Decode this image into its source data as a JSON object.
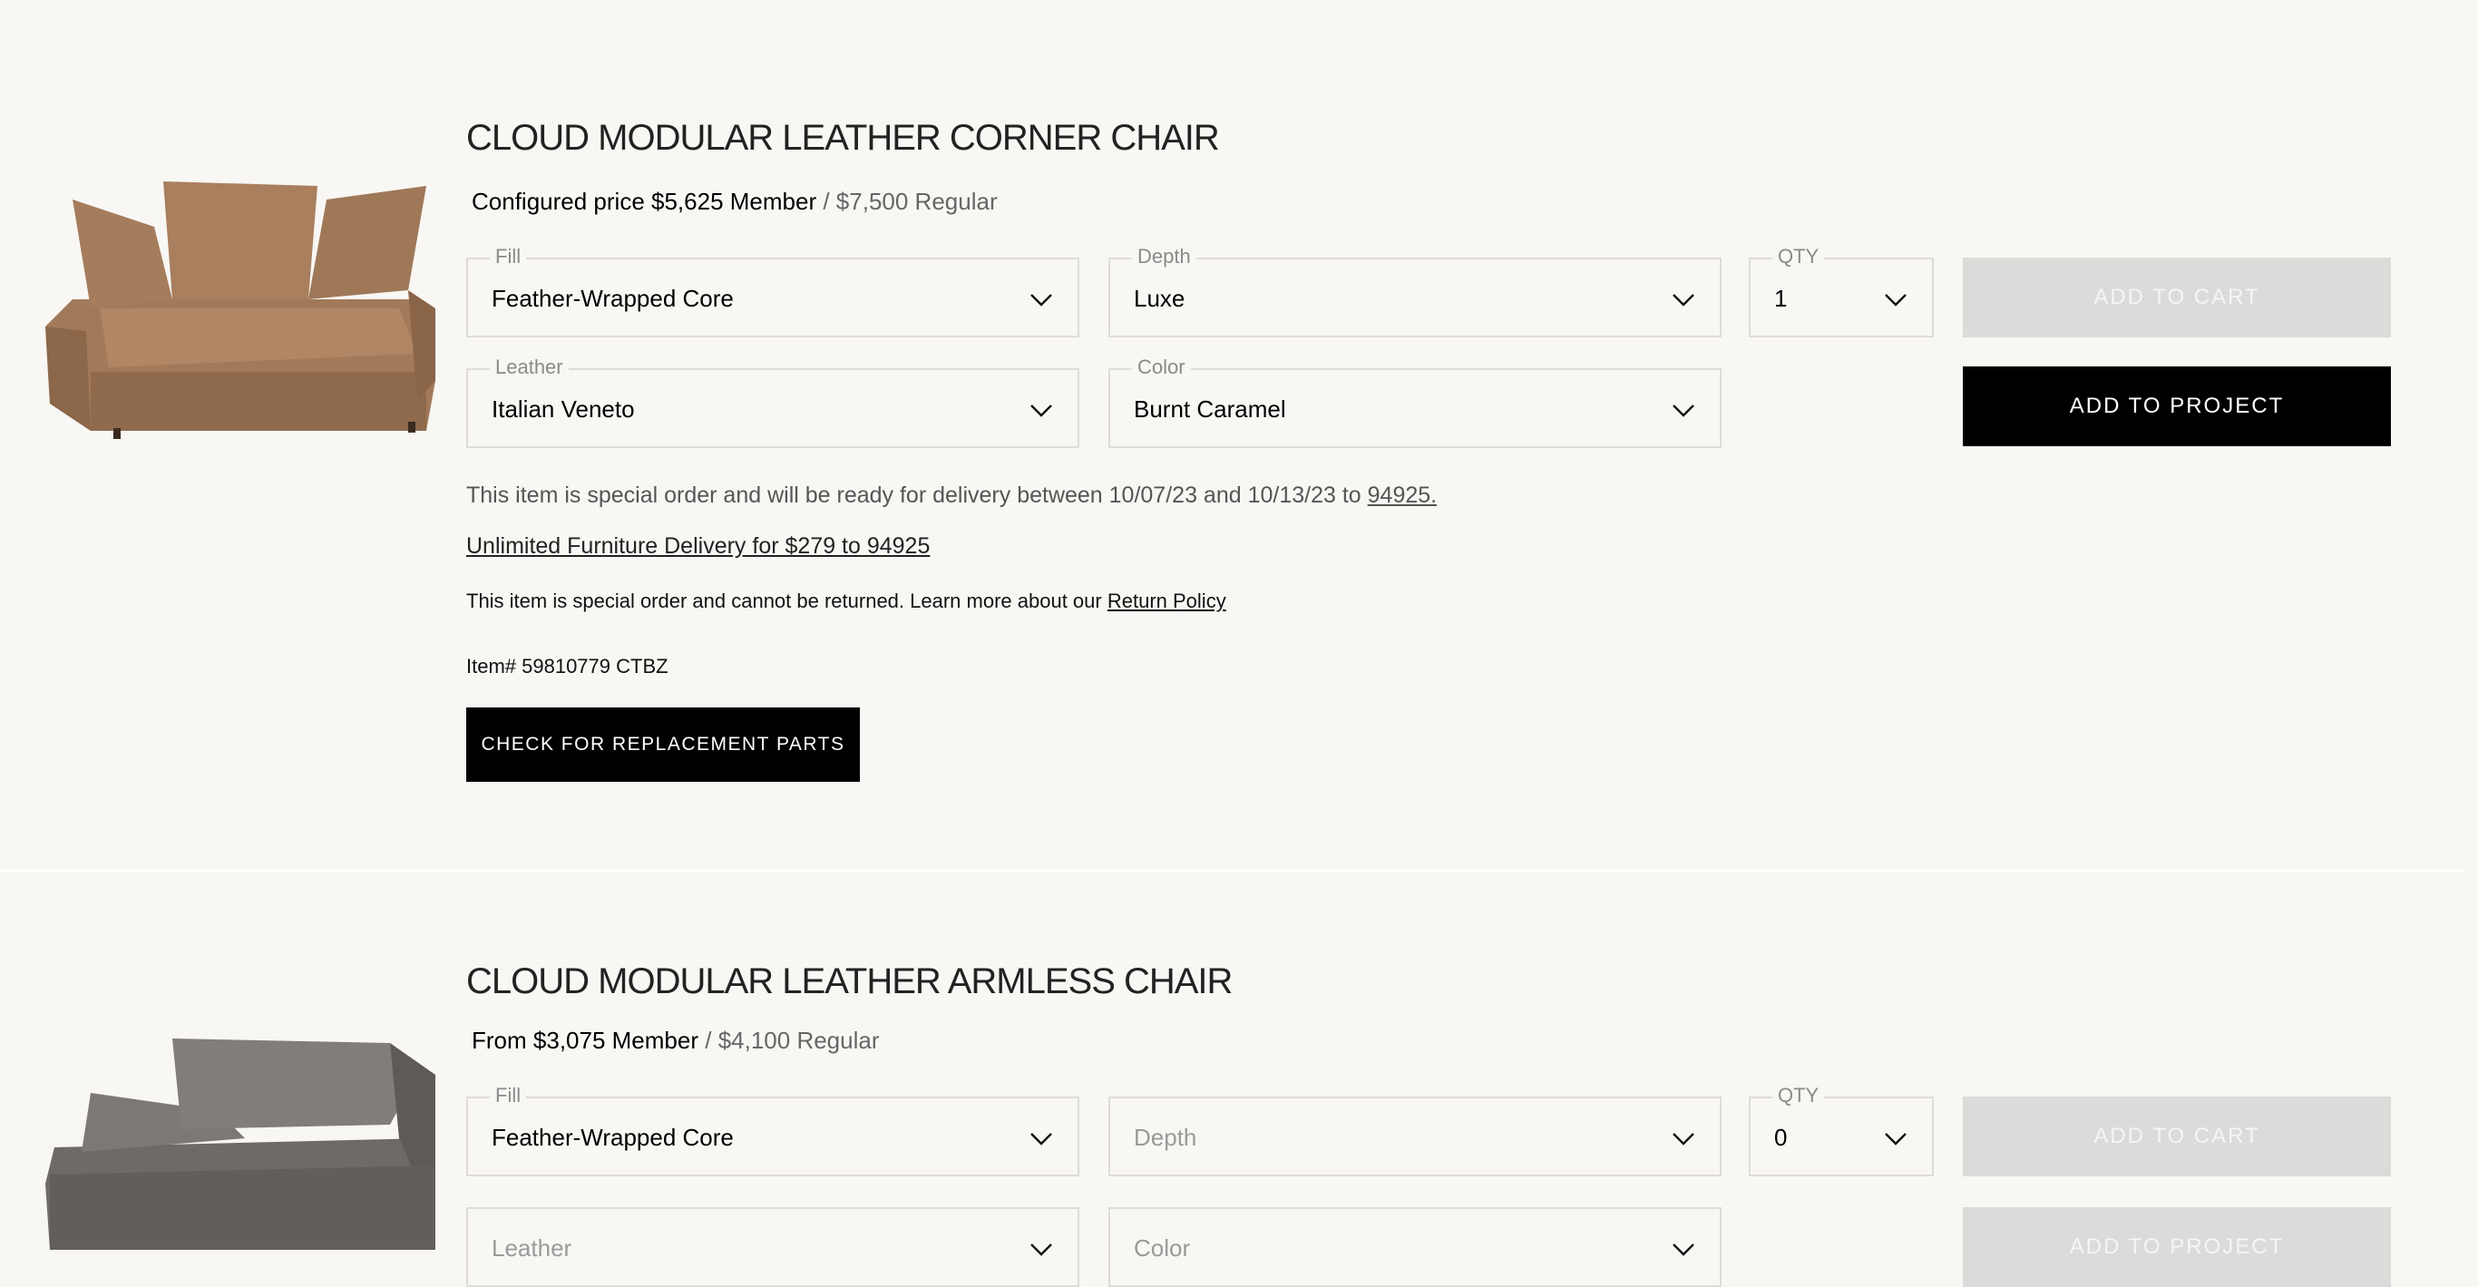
{
  "products": [
    {
      "title": "CLOUD MODULAR LEATHER CORNER CHAIR",
      "price_prefix": "Configured price",
      "member_price": "$5,625 Member",
      "regular_price": "/ $7,500 Regular",
      "fields": {
        "fill": {
          "label": "Fill",
          "value": "Feather-Wrapped Core"
        },
        "depth": {
          "label": "Depth",
          "value": "Luxe"
        },
        "qty": {
          "label": "QTY",
          "value": "1"
        },
        "leather": {
          "label": "Leather",
          "value": "Italian Veneto"
        },
        "color": {
          "label": "Color",
          "value": "Burnt Caramel"
        }
      },
      "add_to_cart": "ADD TO CART",
      "add_to_project": "ADD TO PROJECT",
      "delivery_text": "This item is special order and will be ready for delivery between 10/07/23 and 10/13/23 to",
      "delivery_zip": "94925.",
      "unlimited_delivery": "Unlimited Furniture Delivery for $279 to 94925",
      "return_text": "This item is special order and cannot be returned. Learn more about our",
      "return_link": "Return Policy",
      "item_number": "Item# 59810779 CTBZ",
      "replacement_parts": "CHECK FOR REPLACEMENT PARTS",
      "image_color": "#9a7456"
    },
    {
      "title": "CLOUD MODULAR LEATHER ARMLESS CHAIR",
      "price_prefix": "From",
      "member_price": "$3,075 Member",
      "regular_price": "/ $4,100 Regular",
      "fields": {
        "fill": {
          "label": "Fill",
          "value": "Feather-Wrapped Core"
        },
        "depth": {
          "placeholder": "Depth"
        },
        "qty": {
          "label": "QTY",
          "value": "0"
        },
        "leather": {
          "placeholder": "Leather"
        },
        "color": {
          "placeholder": "Color"
        }
      },
      "add_to_cart": "ADD TO CART",
      "add_to_project": "ADD TO PROJECT",
      "image_color": "#6e6a66"
    }
  ]
}
